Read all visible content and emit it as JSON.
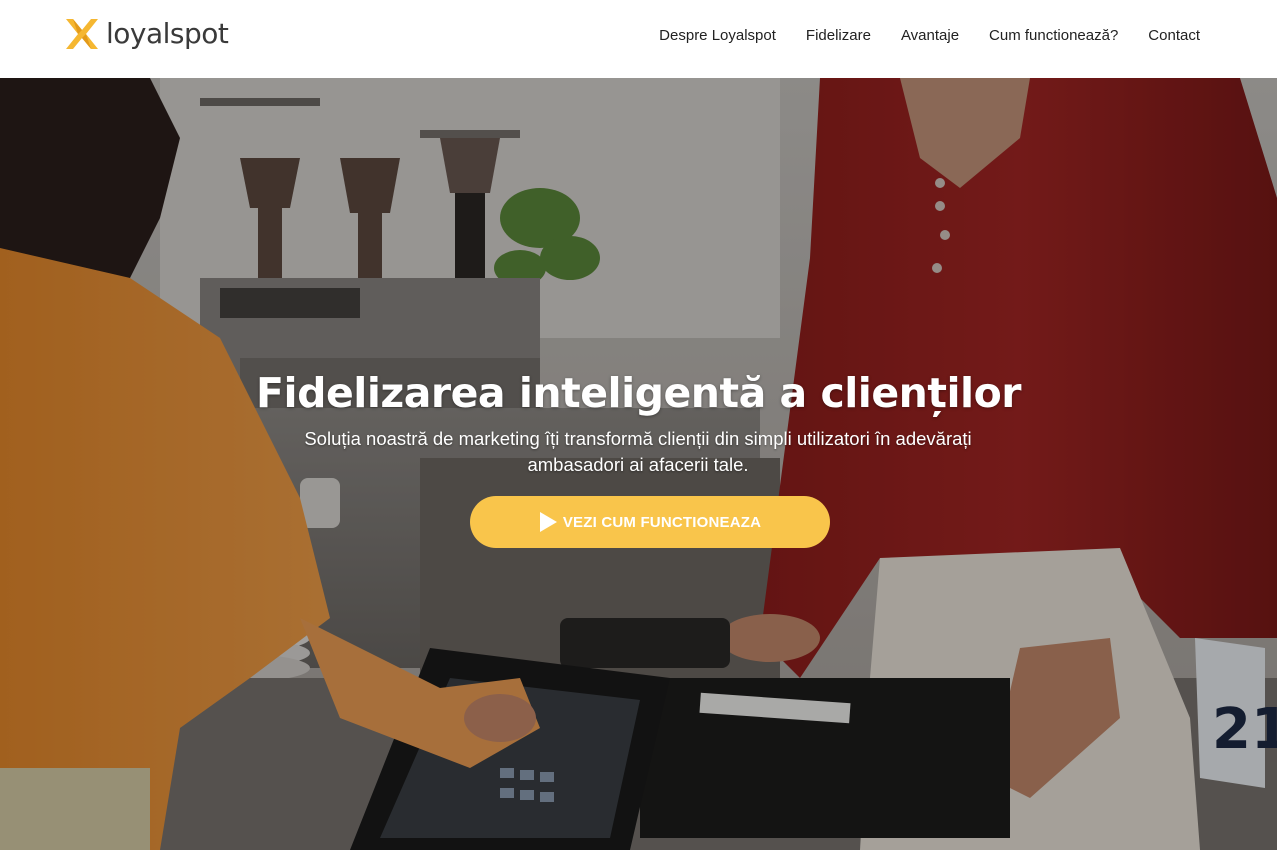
{
  "header": {
    "logo_text": "loyalspot",
    "nav": [
      {
        "label": "Despre Loyalspot"
      },
      {
        "label": "Fidelizare"
      },
      {
        "label": "Avantaje"
      },
      {
        "label": "Cum functionează?"
      },
      {
        "label": "Contact"
      }
    ]
  },
  "hero": {
    "headline": "Fidelizarea inteligentă a clienților",
    "subline": "Soluția noastră de marketing îți transformă clienții din simpli utilizatori în adevărați ambasadori ai afacerii tale.",
    "cta_label": "VEZI CUM FUNCTIONEAZA",
    "cta_icon": "play-icon",
    "background_icon_names": [
      "coffee-shop-photo"
    ],
    "table_number": "21"
  },
  "colors": {
    "accent": "#f9c54b",
    "logo_mark": "#f5b731",
    "text_dark": "#222222"
  }
}
